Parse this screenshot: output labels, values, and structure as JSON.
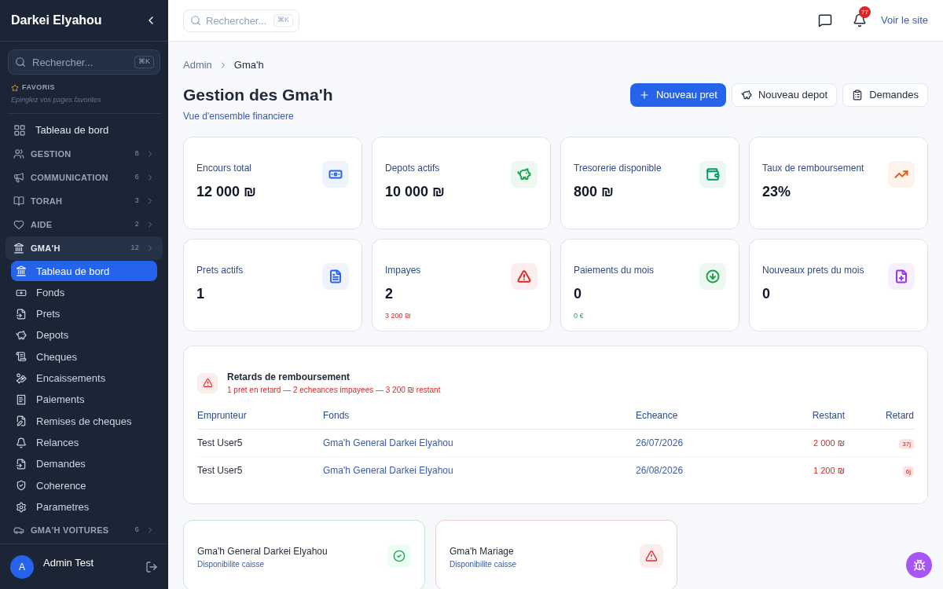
{
  "sidebar": {
    "title": "Darkei Elyahou",
    "search": {
      "placeholder": "Rechercher...",
      "shortcut": "⌘K"
    },
    "favorites": {
      "title": "FAVORIS",
      "hint": "Epinglez vos pages favorites"
    },
    "items": [
      {
        "kind": "link",
        "label": "Tableau de bord"
      },
      {
        "kind": "section",
        "label": "GESTION",
        "count": "8",
        "expanded": false
      },
      {
        "kind": "section",
        "label": "COMMUNICATION",
        "count": "6",
        "expanded": false
      },
      {
        "kind": "section",
        "label": "TORAH",
        "count": "3",
        "expanded": false
      },
      {
        "kind": "section",
        "label": "AIDE",
        "count": "2",
        "expanded": false
      },
      {
        "kind": "section",
        "label": "GMA'H",
        "count": "12",
        "expanded": true,
        "children": [
          {
            "label": "Tableau de bord",
            "selected": true
          },
          {
            "label": "Fonds",
            "selected": false
          },
          {
            "label": "Prets",
            "selected": false
          },
          {
            "label": "Depots",
            "selected": false
          },
          {
            "label": "Cheques",
            "selected": false
          },
          {
            "label": "Encaissements",
            "selected": false
          },
          {
            "label": "Paiements",
            "selected": false
          },
          {
            "label": "Remises de cheques",
            "selected": false
          },
          {
            "label": "Relances",
            "selected": false
          },
          {
            "label": "Demandes",
            "selected": false
          },
          {
            "label": "Coherence",
            "selected": false
          },
          {
            "label": "Parametres",
            "selected": false
          }
        ]
      },
      {
        "kind": "section",
        "label": "GMA'H VOITURES",
        "count": "6",
        "expanded": false
      }
    ],
    "user": {
      "initial": "A",
      "name": "Admin Test"
    }
  },
  "topbar": {
    "search": {
      "placeholder": "Rechercher...",
      "shortcut": "⌘K"
    },
    "notifications": "77",
    "site_link": "Voir le site"
  },
  "breadcrumb": [
    "Admin",
    "Gma'h"
  ],
  "header": {
    "title": "Gestion des Gma'h",
    "subtitle": "Vue d'ensemble financiere",
    "buttons": [
      {
        "kind": "primary",
        "label": "Nouveau pret"
      },
      {
        "kind": "outline",
        "label": "Nouveau depot"
      },
      {
        "kind": "outline",
        "label": "Demandes"
      }
    ]
  },
  "stats": [
    {
      "label": "Encours total",
      "value": "12 000 ₪",
      "color": "#2563eb"
    },
    {
      "label": "Depots actifs",
      "value": "10 000 ₪",
      "color": "#16a34a"
    },
    {
      "label": "Tresorerie disponible",
      "value": "800 ₪",
      "color": "#059669"
    },
    {
      "label": "Taux de remboursement",
      "value": "23%",
      "color": "#ea580c"
    },
    {
      "label": "Prets actifs",
      "value": "1",
      "color": "#2563eb"
    },
    {
      "label": "Impayes",
      "value": "2",
      "sub": "3 200 ₪",
      "color": "#dc2626"
    },
    {
      "label": "Paiements du mois",
      "value": "0",
      "sub": "0 €",
      "color": "#16a34a"
    },
    {
      "label": "Nouveaux prets du mois",
      "value": "0",
      "color": "#9333ea"
    }
  ],
  "late_payments": {
    "title": "Retards de remboursement",
    "summary": "1 pret en retard — 2 echeances impayees — 3 200 ₪ restant",
    "columns": [
      "Emprunteur",
      "Fonds",
      "Echeance",
      "Restant",
      "Retard"
    ],
    "rows": [
      [
        "Test User5",
        "Gma'h General Darkei Elyahou",
        "26/07/2026",
        "2 000 ₪",
        "37j"
      ],
      [
        "Test User5",
        "Gma'h General Darkei Elyahou",
        "26/08/2026",
        "1 200 ₪",
        "6j"
      ]
    ]
  },
  "funds": [
    {
      "name": "Gma'h General Darkei Elyahou",
      "caption": "Disponibilite caisse",
      "kind": "ok"
    },
    {
      "name": "Gma'h Mariage",
      "caption": "Disponibilite caisse",
      "kind": "warning"
    }
  ]
}
